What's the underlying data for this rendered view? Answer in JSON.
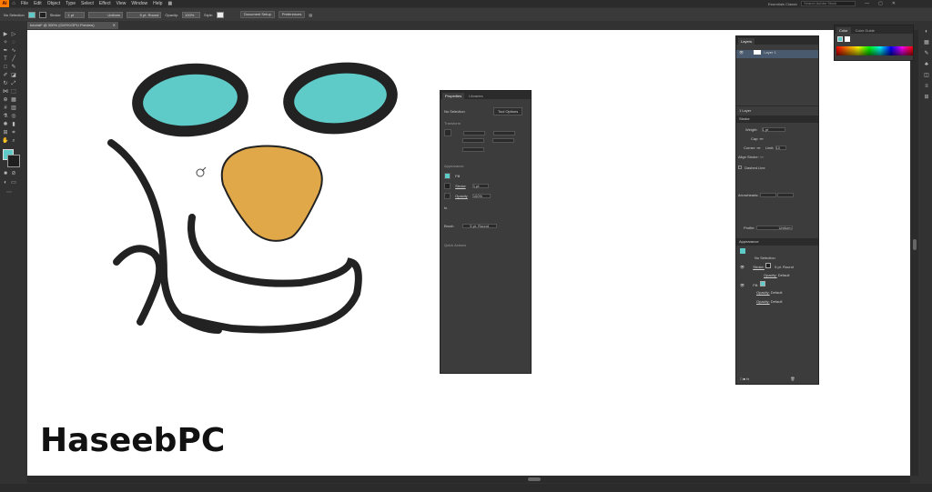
{
  "menubar": {
    "logo": "Ai",
    "items": [
      "File",
      "Edit",
      "Object",
      "Type",
      "Select",
      "Effect",
      "View",
      "Window",
      "Help"
    ],
    "workspace": "Essentials Classic",
    "search_placeholder": "Search Adobe Stock"
  },
  "controlbar": {
    "selection_label": "No Selection",
    "stroke_label": "Stroke:",
    "stroke_weight": "1 pt",
    "uniform": "Uniform",
    "brush": "5 pt. Round",
    "opacity_label": "Opacity:",
    "opacity_value": "100%",
    "style_label": "Style:",
    "document_setup": "Document Setup",
    "preferences": "Preferences",
    "fill_color": "#5fcbc8"
  },
  "document_tab": {
    "title": "tutorial* @ 300% (CMYK/GPU Preview)"
  },
  "canvas": {
    "eye_color": "#5fcbc8",
    "nose_color": "#e1a84a",
    "stroke_color": "#222222"
  },
  "properties_panel": {
    "tabs": [
      "Properties",
      "Libraries"
    ],
    "no_selection": "No Selection",
    "tool_options": "Tool Options",
    "transform": "Transform",
    "appearance": "Appearance",
    "fill": "Fill",
    "stroke": "Stroke",
    "stroke_value": "1 pt",
    "opacity": "Opacity",
    "opacity_value": "100%",
    "brush": "Brush",
    "brush_value": "5 pt. Round",
    "quick_actions": "Quick Actions"
  },
  "layers_panel": {
    "tab": "Layers",
    "layer_name": "Layer 1",
    "layer_count": "1 Layer",
    "stroke_tab": "Stroke",
    "weight_label": "Weight:",
    "weight_value": "1 pt",
    "cap_label": "Cap:",
    "corner_label": "Corner:",
    "limit_label": "Limit:",
    "limit_value": "10",
    "align_label": "Align Stroke:",
    "dashed_line": "Dashed Line",
    "arrowheads": "Arrowheads:",
    "profile_label": "Profile:",
    "profile_value": "Uniform",
    "appearance_tab": "Appearance",
    "app_no_selection": "No Selection",
    "app_stroke": "Stroke:",
    "app_stroke_value": "5 pt. Round",
    "app_opacity": "Opacity:",
    "app_default": "Default",
    "app_fill": "Fill:"
  },
  "color_panel": {
    "tabs": [
      "Color",
      "Color Guide"
    ]
  },
  "watermark": "HaseebPC"
}
